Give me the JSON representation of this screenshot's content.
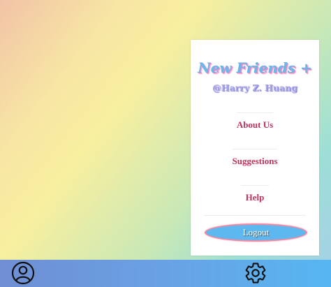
{
  "menu": {
    "app_title": "New Friends +",
    "username": "@Harry Z. Huang",
    "items": [
      {
        "label": "About Us"
      },
      {
        "label": "Suggestions"
      },
      {
        "label": "Help"
      }
    ],
    "logout_label": "Logout"
  },
  "bottom_nav": {
    "left_icon": "user-profile-icon",
    "right_icon": "gear-icon"
  },
  "colors": {
    "menu_item_text": "#c0315b",
    "title_text": "#6ab8ea",
    "logout_button": "#5cb8ef",
    "logout_border": "#ef8aa2",
    "bottom_bar": "#6aa0e3"
  }
}
